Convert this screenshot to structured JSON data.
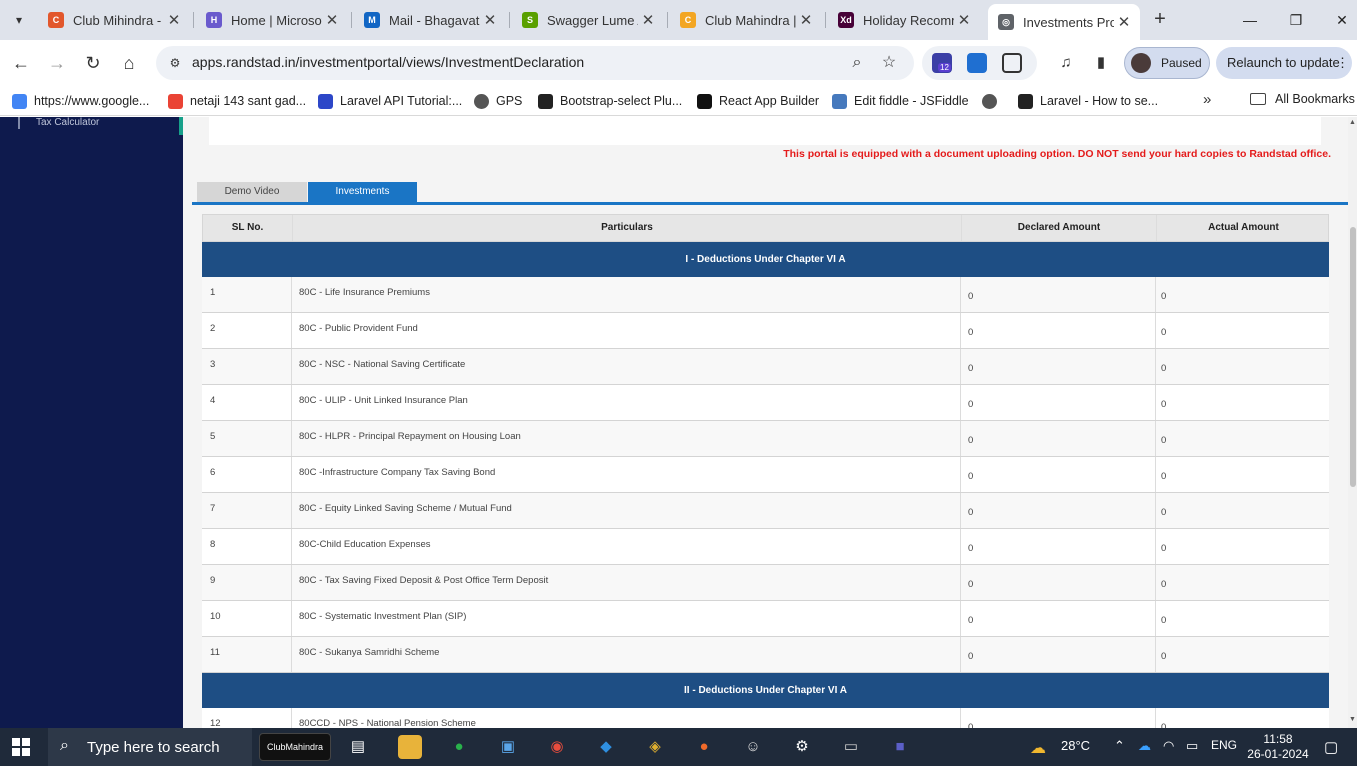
{
  "browser": {
    "tabs": [
      {
        "title": "Club Mihindra - ",
        "color": "#e2572c",
        "glyph": "C"
      },
      {
        "title": "Home | Microsof",
        "color": "#6a5acd",
        "glyph": "H"
      },
      {
        "title": "Mail - Bhagavat",
        "color": "#1266c4",
        "glyph": "M"
      },
      {
        "title": "Swagger Lume A",
        "color": "#5aa000",
        "glyph": "S"
      },
      {
        "title": "Club Mahindra |",
        "color": "#f3a623",
        "glyph": "C"
      },
      {
        "title": "Holiday Recomm",
        "color": "#470137",
        "glyph": "Xd"
      },
      {
        "title": "Investments Pro",
        "color": "#5f6368",
        "glyph": "◎"
      }
    ],
    "active_tab_index": 6,
    "url": "apps.randstad.in/investmentportal/views/InvestmentDeclaration",
    "extensions_badge": "12",
    "profile_status": "Paused",
    "relaunch_label": "Relaunch to update",
    "bookmarks": [
      {
        "label": "https://www.google...",
        "color": "#4285f4"
      },
      {
        "label": "netaji 143 sant gad...",
        "color": "#ea4335"
      },
      {
        "label": "Laravel API Tutorial:...",
        "color": "#2d47c8"
      },
      {
        "label": "GPS",
        "color": "#555555"
      },
      {
        "label": "Bootstrap-select Plu...",
        "color": "#222222"
      },
      {
        "label": "React App Builder",
        "color": "#111111"
      },
      {
        "label": "Edit fiddle - JSFiddle",
        "color": "#4679bd"
      },
      {
        "label": "",
        "color": "#555555"
      },
      {
        "label": "Laravel - How to se...",
        "color": "#222222"
      }
    ],
    "bookmarks_more": "»",
    "all_bookmarks": "All Bookmarks"
  },
  "sidebar": {
    "item": "Tax Calculator"
  },
  "page": {
    "notice": "This portal is equipped with a document uploading option. DO NOT send your hard copies to Randstad office.",
    "tabs": [
      "Demo Video",
      "Investments"
    ],
    "table": {
      "headers": [
        "SL No.",
        "Particulars",
        "Declared Amount",
        "Actual Amount"
      ],
      "sections": [
        {
          "title": "I - Deductions Under Chapter VI A",
          "rows": [
            {
              "sl": "1",
              "particular": "80C - Life Insurance Premiums",
              "declared": "0",
              "actual": "0"
            },
            {
              "sl": "2",
              "particular": "80C - Public Provident Fund",
              "declared": "0",
              "actual": "0"
            },
            {
              "sl": "3",
              "particular": "80C - NSC - National Saving Certificate",
              "declared": "0",
              "actual": "0"
            },
            {
              "sl": "4",
              "particular": "80C - ULIP - Unit Linked Insurance Plan",
              "declared": "0",
              "actual": "0"
            },
            {
              "sl": "5",
              "particular": "80C - HLPR - Principal Repayment on Housing Loan",
              "declared": "0",
              "actual": "0"
            },
            {
              "sl": "6",
              "particular": "80C -Infrastructure Company Tax Saving Bond",
              "declared": "0",
              "actual": "0"
            },
            {
              "sl": "7",
              "particular": "80C - Equity Linked Saving Scheme / Mutual Fund",
              "declared": "0",
              "actual": "0"
            },
            {
              "sl": "8",
              "particular": "80C-Child Education Expenses",
              "declared": "0",
              "actual": "0"
            },
            {
              "sl": "9",
              "particular": "80C - Tax Saving Fixed Deposit & Post Office Term Deposit",
              "declared": "0",
              "actual": "0"
            },
            {
              "sl": "10",
              "particular": "80C - Systematic Investment Plan (SIP)",
              "declared": "0",
              "actual": "0"
            },
            {
              "sl": "11",
              "particular": "80C - Sukanya Samridhi Scheme",
              "declared": "0",
              "actual": "0"
            }
          ]
        },
        {
          "title": "II - Deductions Under Chapter VI A",
          "rows": [
            {
              "sl": "12",
              "particular": "80CCD - NPS - National Pension Scheme",
              "declared": "0",
              "actual": "0"
            }
          ]
        }
      ]
    }
  },
  "taskbar": {
    "search_placeholder": "Type here to search",
    "pinned_app_label": "ClubMahindra",
    "weather": "28°C",
    "language": "ENG",
    "time": "11:58",
    "date": "26-01-2024"
  },
  "colors": {
    "sidebar": "#0e1a4d",
    "section_header": "#1e4e84",
    "tab_active": "#1a75c5",
    "notice": "#e41b1b"
  }
}
